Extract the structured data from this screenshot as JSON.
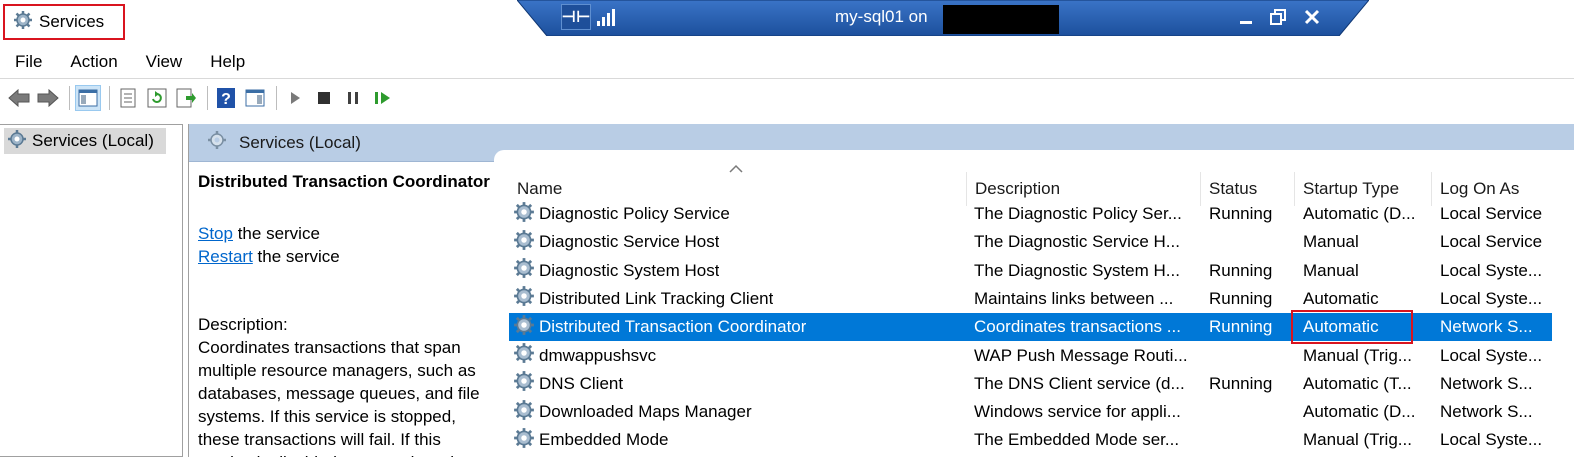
{
  "window": {
    "title": "Services"
  },
  "remote_bar": {
    "title": "my-sql01 on "
  },
  "menu": {
    "items": [
      "File",
      "Action",
      "View",
      "Help"
    ]
  },
  "tree": {
    "root_label": "Services (Local)"
  },
  "pane_header": {
    "label": "Services (Local)"
  },
  "details": {
    "service_name": "Distributed Transaction Coordinator",
    "stop_link": "Stop",
    "stop_suffix": " the service",
    "restart_link": "Restart",
    "restart_suffix": " the service",
    "description_label": "Description:",
    "description_text": "Coordinates transactions that span multiple resource managers, such as databases, message queues, and file systems. If this service is stopped, these transactions will fail. If this service is disabled, any services that"
  },
  "columns": {
    "name": "Name",
    "description": "Description",
    "status": "Status",
    "startup_type": "Startup Type",
    "log_on_as": "Log On As"
  },
  "rows": [
    {
      "name": "Diagnostic Policy Service",
      "description": "The Diagnostic Policy Ser...",
      "status": "Running",
      "startup": "Automatic (D...",
      "logon": "Local Service"
    },
    {
      "name": "Diagnostic Service Host",
      "description": "The Diagnostic Service H...",
      "status": "",
      "startup": "Manual",
      "logon": "Local Service"
    },
    {
      "name": "Diagnostic System Host",
      "description": "The Diagnostic System H...",
      "status": "Running",
      "startup": "Manual",
      "logon": "Local Syste..."
    },
    {
      "name": "Distributed Link Tracking Client",
      "description": "Maintains links between ...",
      "status": "Running",
      "startup": "Automatic",
      "logon": "Local Syste..."
    },
    {
      "name": "Distributed Transaction Coordinator",
      "description": "Coordinates transactions ...",
      "status": "Running",
      "startup": "Automatic",
      "logon": "Network S...",
      "selected": true
    },
    {
      "name": "dmwappushsvc",
      "description": "WAP Push Message Routi...",
      "status": "",
      "startup": "Manual (Trig...",
      "logon": "Local Syste..."
    },
    {
      "name": "DNS Client",
      "description": "The DNS Client service (d...",
      "status": "Running",
      "startup": "Automatic (T...",
      "logon": "Network S..."
    },
    {
      "name": "Downloaded Maps Manager",
      "description": "Windows service for appli...",
      "status": "",
      "startup": "Automatic (D...",
      "logon": "Network S..."
    },
    {
      "name": "Embedded Mode",
      "description": "The Embedded Mode ser...",
      "status": "",
      "startup": "Manual (Trig...",
      "logon": "Local Syste..."
    }
  ],
  "colors": {
    "selection": "#0078d7",
    "highlight_box": "#d9141f",
    "pane_header": "#b9cde5",
    "link": "#0066cc"
  }
}
